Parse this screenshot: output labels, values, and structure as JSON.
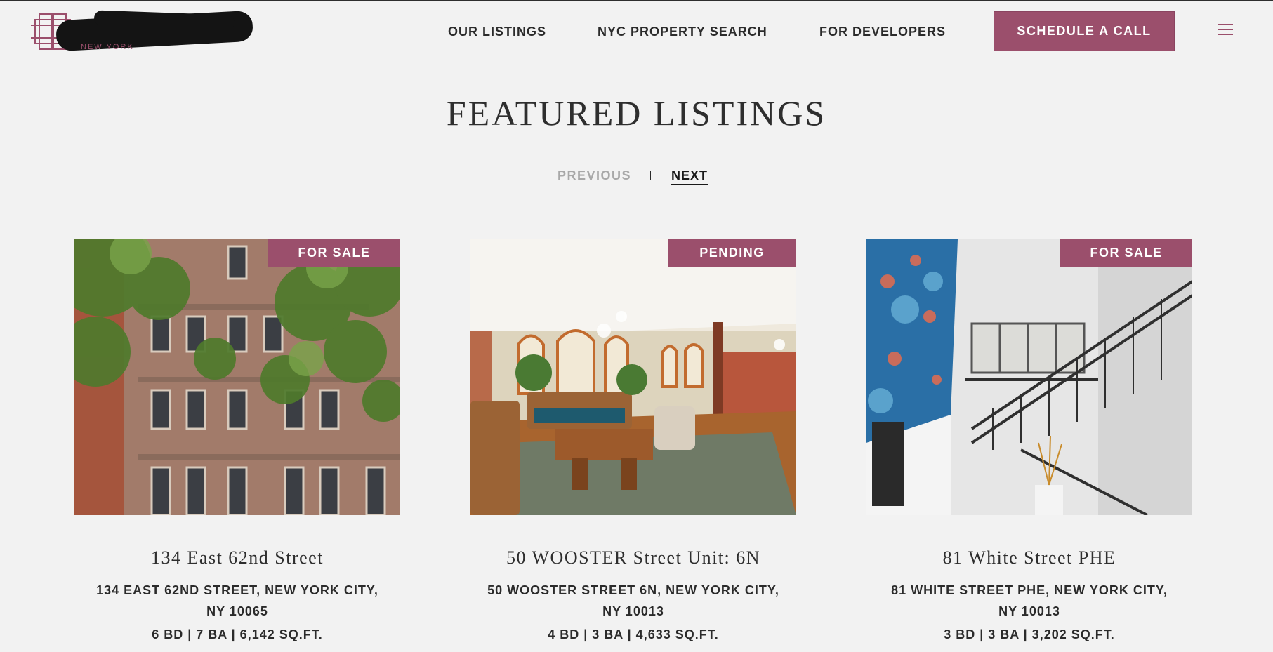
{
  "brand": {
    "location": "NEW YORK",
    "accent": "#9b4f6c"
  },
  "nav": {
    "links": [
      "OUR LISTINGS",
      "NYC PROPERTY SEARCH",
      "FOR DEVELOPERS"
    ],
    "cta": "SCHEDULE A CALL",
    "menu_icon": "hamburger-menu-icon"
  },
  "section": {
    "title": "FEATURED LISTINGS",
    "prev": "PREVIOUS",
    "next": "NEXT"
  },
  "listings": [
    {
      "status": "FOR SALE",
      "title": "134 East 62nd Street",
      "address": "134 EAST 62ND STREET, NEW YORK CITY, NY 10065",
      "specs": "6 BD | 7 BA | 6,142 SQ.FT."
    },
    {
      "status": "PENDING",
      "title": "50 WOOSTER Street Unit: 6N",
      "address": "50 WOOSTER STREET 6N, NEW YORK CITY, NY 10013",
      "specs": "4 BD | 3 BA | 4,633 SQ.FT."
    },
    {
      "status": "FOR SALE",
      "title": "81 White Street PHE",
      "address": "81 WHITE STREET PHE, NEW YORK CITY, NY 10013",
      "specs": "3 BD | 3 BA | 3,202 SQ.FT."
    }
  ]
}
